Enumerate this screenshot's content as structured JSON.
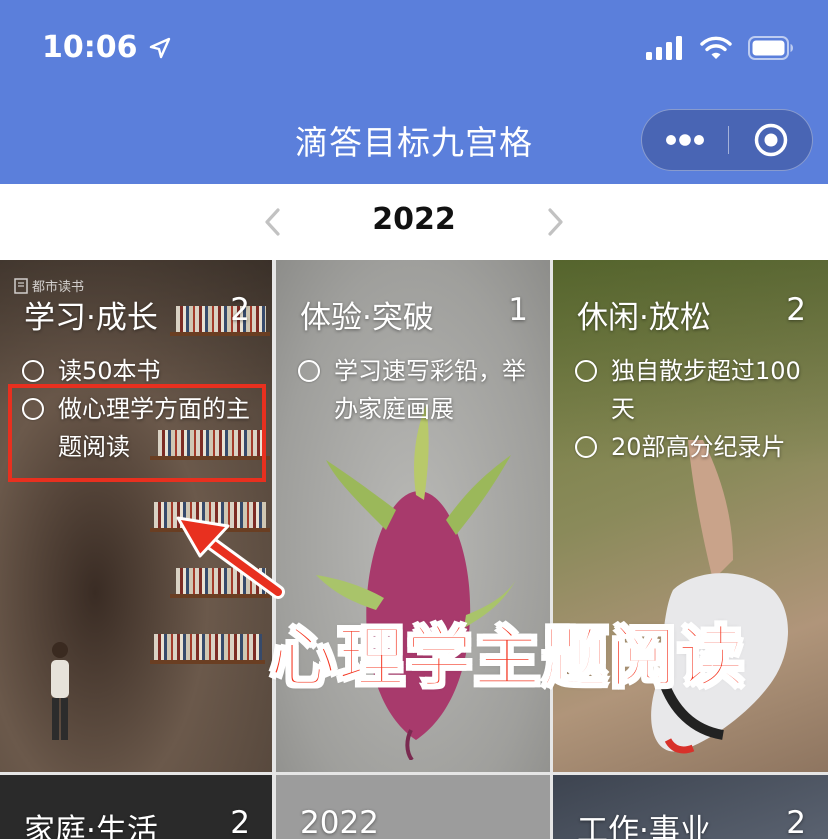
{
  "status_bar": {
    "time": "10:06"
  },
  "nav": {
    "title": "滴答目标九宫格"
  },
  "year_bar": {
    "year": "2022"
  },
  "grid": {
    "cells": [
      {
        "title": "学习·成长",
        "count": "2",
        "goals": [
          "读50本书",
          "做心理学方面的主题阅读"
        ],
        "watermark": "都市读书"
      },
      {
        "title": "体验·突破",
        "count": "1",
        "goals": [
          "学习速写彩铅，举办家庭画展"
        ]
      },
      {
        "title": "休闲·放松",
        "count": "2",
        "goals": [
          "独自散步超过100天",
          "20部高分纪录片"
        ]
      },
      {
        "title": "家庭·生活",
        "count": "2"
      },
      {
        "title": "2022"
      },
      {
        "title": "工作·事业",
        "count": "2"
      }
    ]
  },
  "annotation": {
    "text": "心理学主题阅读",
    "color": "#f4341f"
  },
  "colors": {
    "header": "#5b7fdb",
    "highlight": "#e8301f"
  }
}
